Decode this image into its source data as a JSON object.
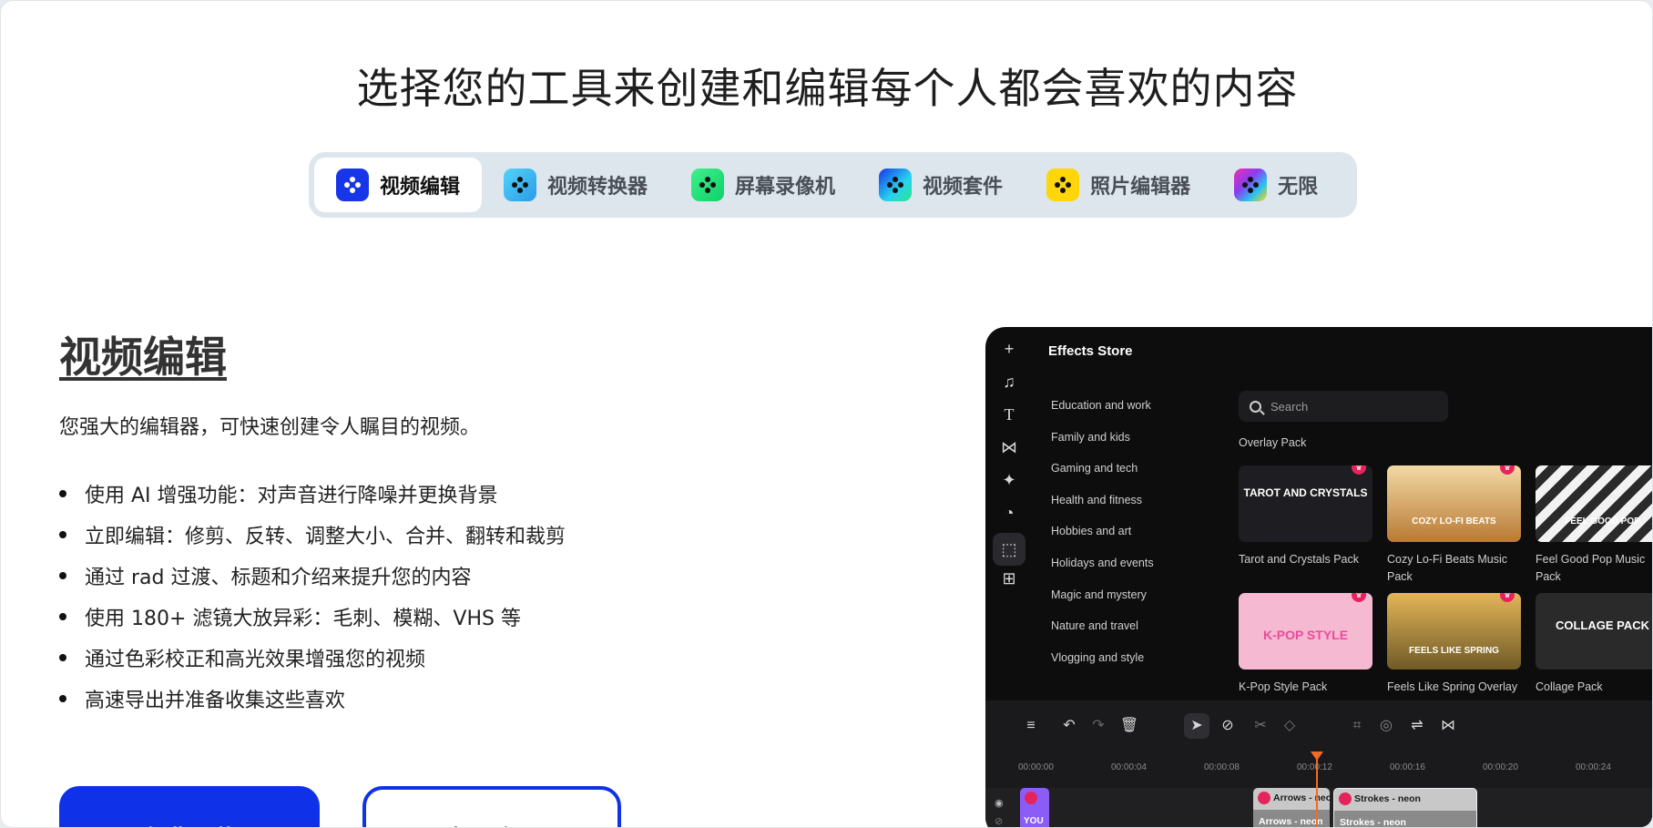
{
  "headline": "选择您的工具来创建和编辑每个人都会喜欢的内容",
  "tabs": [
    {
      "label": "视频编辑",
      "color": "#1736e8",
      "active": true
    },
    {
      "label": "视频转换器",
      "color": "#3ec6f2"
    },
    {
      "label": "屏幕录像机",
      "color": "#16e46c"
    },
    {
      "label": "视频套件",
      "color": "#2a7bf0"
    },
    {
      "label": "照片编辑器",
      "color": "#ffd60a"
    },
    {
      "label": "无限",
      "color": "#c84cf0"
    }
  ],
  "section": {
    "title": "视频编辑",
    "description": "您强大的编辑器，可快速创建令人瞩目的视频。",
    "bullets": [
      "使用 AI 增强功能：对声音进行降噪并更换背景",
      "立即编辑：修剪、反转、调整大小、合并、翻转和裁剪",
      "通过 rad 过渡、标题和介绍来提升您的内容",
      "使用 180+ 滤镜大放异彩：毛刺、模糊、VHS 等",
      "通过色彩校正和高光效果增强您的视频",
      "高速导出并准备收集这些喜欢"
    ],
    "primary_button": "免费下载",
    "secondary_button": "立即购买"
  },
  "app": {
    "store_title": "Effects Store",
    "search_placeholder": "Search",
    "overlay_label": "Overlay Pack",
    "categories": [
      "Education and work",
      "Family and kids",
      "Gaming and tech",
      "Health and fitness",
      "Hobbies and art",
      "Holidays and events",
      "Magic and mystery",
      "Nature and travel",
      "Vlogging and style"
    ],
    "packs": [
      {
        "label": "Tarot and Crystals Pack",
        "thumb_text": "TAROT AND CRYSTALS",
        "bg": "#1d1d22"
      },
      {
        "label": "Cozy Lo-Fi Beats Music Pack",
        "thumb_text": "COZY LO-FI BEATS",
        "bg": "#d9a35a"
      },
      {
        "label": "Feel Good Pop Music Pack",
        "thumb_text": "FEEL GOOD POP",
        "bg": "#e9e9e9"
      },
      {
        "label": "K-Pop Style Pack",
        "thumb_text": "K-POP STYLE",
        "bg": "#f6b9d2"
      },
      {
        "label": "Feels Like Spring Overlay",
        "thumb_text": "FEELS LIKE SPRING",
        "bg": "#c59a3c"
      },
      {
        "label": "Collage Pack",
        "thumb_text": "COLLAGE PACK",
        "bg": "#2a2a2a"
      }
    ],
    "timeline_ticks": [
      "00:00:00",
      "00:00:04",
      "00:00:08",
      "00:00:12",
      "00:00:16",
      "00:00:20",
      "00:00:24"
    ],
    "clips": {
      "small": {
        "bottom": "YOU"
      },
      "arrows": {
        "top": "Arrows - neon",
        "bottom": "Arrows - neon"
      },
      "strokes": {
        "top": "Strokes - neon",
        "bottom": "Strokes - neon"
      }
    }
  }
}
